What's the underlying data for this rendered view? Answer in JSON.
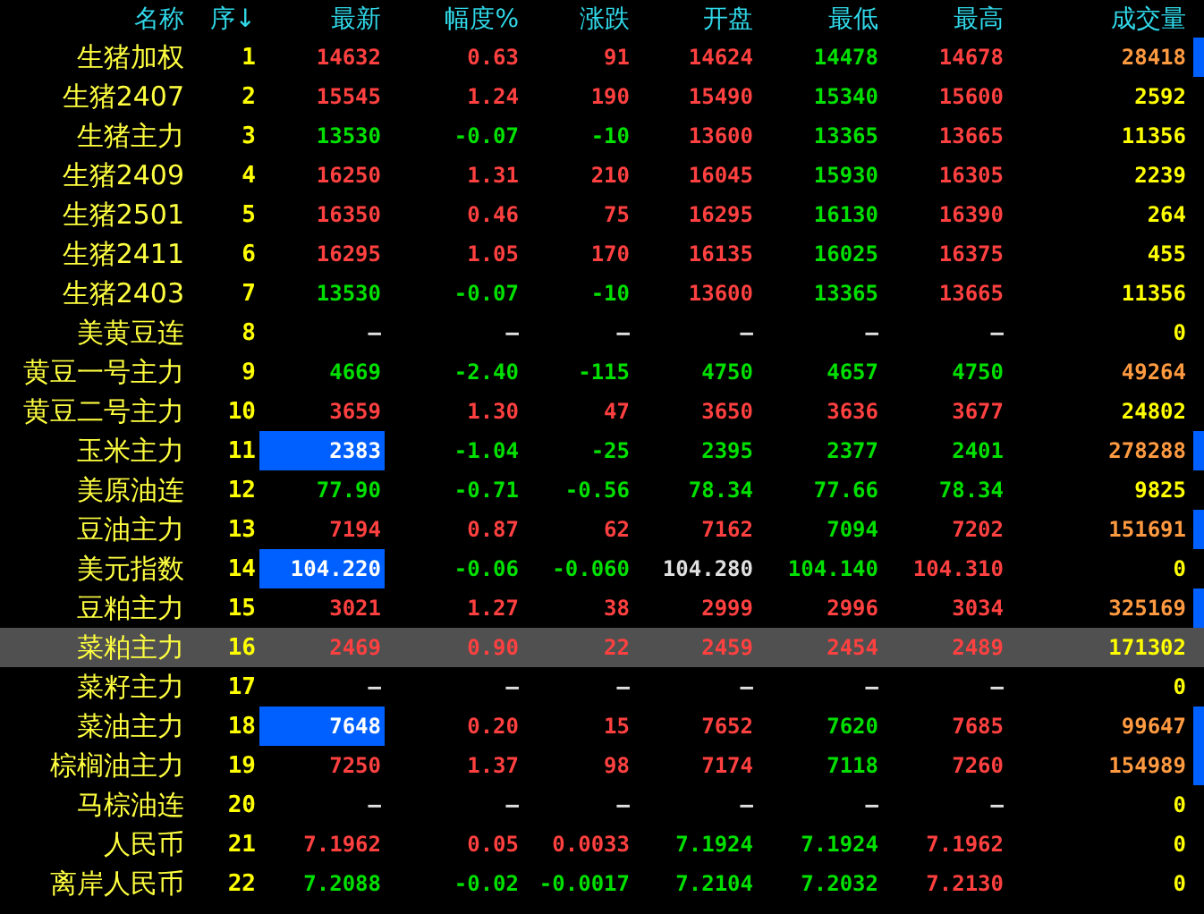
{
  "columns": [
    "名称",
    "序↓",
    "最新",
    "幅度%",
    "涨跌",
    "开盘",
    "最低",
    "最高",
    "成交量"
  ],
  "rows": [
    {
      "name": "生猪加权",
      "seq": "1",
      "selected": false,
      "marker": true,
      "flash": false,
      "cells": [
        {
          "text": "14632",
          "color": "#ff4040"
        },
        {
          "text": "0.63",
          "color": "#ff4040"
        },
        {
          "text": "91",
          "color": "#ff4040"
        },
        {
          "text": "14624",
          "color": "#ff4040"
        },
        {
          "text": "14478",
          "color": "#00e000"
        },
        {
          "text": "14678",
          "color": "#ff4040"
        },
        {
          "text": "28418",
          "color": "#ff9a40"
        }
      ]
    },
    {
      "name": "生猪2407",
      "seq": "2",
      "selected": false,
      "marker": false,
      "flash": false,
      "cells": [
        {
          "text": "15545",
          "color": "#ff4040"
        },
        {
          "text": "1.24",
          "color": "#ff4040"
        },
        {
          "text": "190",
          "color": "#ff4040"
        },
        {
          "text": "15490",
          "color": "#ff4040"
        },
        {
          "text": "15340",
          "color": "#00e000"
        },
        {
          "text": "15600",
          "color": "#ff4040"
        },
        {
          "text": "2592",
          "color": "#ffff00"
        }
      ]
    },
    {
      "name": "生猪主力",
      "seq": "3",
      "selected": false,
      "marker": false,
      "flash": false,
      "cells": [
        {
          "text": "13530",
          "color": "#00e000"
        },
        {
          "text": "-0.07",
          "color": "#00e000"
        },
        {
          "text": "-10",
          "color": "#00e000"
        },
        {
          "text": "13600",
          "color": "#ff4040"
        },
        {
          "text": "13365",
          "color": "#00e000"
        },
        {
          "text": "13665",
          "color": "#ff4040"
        },
        {
          "text": "11356",
          "color": "#ffff00"
        }
      ]
    },
    {
      "name": "生猪2409",
      "seq": "4",
      "selected": false,
      "marker": false,
      "flash": false,
      "cells": [
        {
          "text": "16250",
          "color": "#ff4040"
        },
        {
          "text": "1.31",
          "color": "#ff4040"
        },
        {
          "text": "210",
          "color": "#ff4040"
        },
        {
          "text": "16045",
          "color": "#ff4040"
        },
        {
          "text": "15930",
          "color": "#00e000"
        },
        {
          "text": "16305",
          "color": "#ff4040"
        },
        {
          "text": "2239",
          "color": "#ffff00"
        }
      ]
    },
    {
      "name": "生猪2501",
      "seq": "5",
      "selected": false,
      "marker": false,
      "flash": false,
      "cells": [
        {
          "text": "16350",
          "color": "#ff4040"
        },
        {
          "text": "0.46",
          "color": "#ff4040"
        },
        {
          "text": "75",
          "color": "#ff4040"
        },
        {
          "text": "16295",
          "color": "#ff4040"
        },
        {
          "text": "16130",
          "color": "#00e000"
        },
        {
          "text": "16390",
          "color": "#ff4040"
        },
        {
          "text": "264",
          "color": "#ffff00"
        }
      ]
    },
    {
      "name": "生猪2411",
      "seq": "6",
      "selected": false,
      "marker": false,
      "flash": false,
      "cells": [
        {
          "text": "16295",
          "color": "#ff4040"
        },
        {
          "text": "1.05",
          "color": "#ff4040"
        },
        {
          "text": "170",
          "color": "#ff4040"
        },
        {
          "text": "16135",
          "color": "#ff4040"
        },
        {
          "text": "16025",
          "color": "#00e000"
        },
        {
          "text": "16375",
          "color": "#ff4040"
        },
        {
          "text": "455",
          "color": "#ffff00"
        }
      ]
    },
    {
      "name": "生猪2403",
      "seq": "7",
      "selected": false,
      "marker": false,
      "flash": false,
      "cells": [
        {
          "text": "13530",
          "color": "#00e000"
        },
        {
          "text": "-0.07",
          "color": "#00e000"
        },
        {
          "text": "-10",
          "color": "#00e000"
        },
        {
          "text": "13600",
          "color": "#ff4040"
        },
        {
          "text": "13365",
          "color": "#00e000"
        },
        {
          "text": "13665",
          "color": "#ff4040"
        },
        {
          "text": "11356",
          "color": "#ffff00"
        }
      ]
    },
    {
      "name": "美黄豆连",
      "seq": "8",
      "selected": false,
      "marker": false,
      "flash": false,
      "cells": [
        {
          "text": "—",
          "color": "#e0e0e0"
        },
        {
          "text": "—",
          "color": "#e0e0e0"
        },
        {
          "text": "—",
          "color": "#e0e0e0"
        },
        {
          "text": "—",
          "color": "#e0e0e0"
        },
        {
          "text": "—",
          "color": "#e0e0e0"
        },
        {
          "text": "—",
          "color": "#e0e0e0"
        },
        {
          "text": "0",
          "color": "#ffff00"
        }
      ]
    },
    {
      "name": "黄豆一号主力",
      "seq": "9",
      "selected": false,
      "marker": false,
      "flash": false,
      "cells": [
        {
          "text": "4669",
          "color": "#00e000"
        },
        {
          "text": "-2.40",
          "color": "#00e000"
        },
        {
          "text": "-115",
          "color": "#00e000"
        },
        {
          "text": "4750",
          "color": "#00e000"
        },
        {
          "text": "4657",
          "color": "#00e000"
        },
        {
          "text": "4750",
          "color": "#00e000"
        },
        {
          "text": "49264",
          "color": "#ff9a40"
        }
      ]
    },
    {
      "name": "黄豆二号主力",
      "seq": "10",
      "selected": false,
      "marker": false,
      "flash": false,
      "cells": [
        {
          "text": "3659",
          "color": "#ff4040"
        },
        {
          "text": "1.30",
          "color": "#ff4040"
        },
        {
          "text": "47",
          "color": "#ff4040"
        },
        {
          "text": "3650",
          "color": "#ff4040"
        },
        {
          "text": "3636",
          "color": "#ff4040"
        },
        {
          "text": "3677",
          "color": "#ff4040"
        },
        {
          "text": "24802",
          "color": "#ffff00"
        }
      ]
    },
    {
      "name": "玉米主力",
      "seq": "11",
      "selected": false,
      "marker": true,
      "flash": true,
      "cells": [
        {
          "text": "2383",
          "color": "#ffffff"
        },
        {
          "text": "-1.04",
          "color": "#00e000"
        },
        {
          "text": "-25",
          "color": "#00e000"
        },
        {
          "text": "2395",
          "color": "#00e000"
        },
        {
          "text": "2377",
          "color": "#00e000"
        },
        {
          "text": "2401",
          "color": "#00e000"
        },
        {
          "text": "278288",
          "color": "#ff9a40"
        }
      ]
    },
    {
      "name": "美原油连",
      "seq": "12",
      "selected": false,
      "marker": false,
      "flash": false,
      "cells": [
        {
          "text": "77.90",
          "color": "#00e000"
        },
        {
          "text": "-0.71",
          "color": "#00e000"
        },
        {
          "text": "-0.56",
          "color": "#00e000"
        },
        {
          "text": "78.34",
          "color": "#00e000"
        },
        {
          "text": "77.66",
          "color": "#00e000"
        },
        {
          "text": "78.34",
          "color": "#00e000"
        },
        {
          "text": "9825",
          "color": "#ffff00"
        }
      ]
    },
    {
      "name": "豆油主力",
      "seq": "13",
      "selected": false,
      "marker": true,
      "flash": false,
      "cells": [
        {
          "text": "7194",
          "color": "#ff4040"
        },
        {
          "text": "0.87",
          "color": "#ff4040"
        },
        {
          "text": "62",
          "color": "#ff4040"
        },
        {
          "text": "7162",
          "color": "#ff4040"
        },
        {
          "text": "7094",
          "color": "#00e000"
        },
        {
          "text": "7202",
          "color": "#ff4040"
        },
        {
          "text": "151691",
          "color": "#ff9a40"
        }
      ]
    },
    {
      "name": "美元指数",
      "seq": "14",
      "selected": false,
      "marker": false,
      "flash": true,
      "cells": [
        {
          "text": "104.220",
          "color": "#ffffff"
        },
        {
          "text": "-0.06",
          "color": "#00e000"
        },
        {
          "text": "-0.060",
          "color": "#00e000"
        },
        {
          "text": "104.280",
          "color": "#e0e0e0"
        },
        {
          "text": "104.140",
          "color": "#00e000"
        },
        {
          "text": "104.310",
          "color": "#ff4040"
        },
        {
          "text": "0",
          "color": "#ffff00"
        }
      ]
    },
    {
      "name": "豆粕主力",
      "seq": "15",
      "selected": false,
      "marker": true,
      "flash": false,
      "cells": [
        {
          "text": "3021",
          "color": "#ff4040"
        },
        {
          "text": "1.27",
          "color": "#ff4040"
        },
        {
          "text": "38",
          "color": "#ff4040"
        },
        {
          "text": "2999",
          "color": "#ff4040"
        },
        {
          "text": "2996",
          "color": "#ff4040"
        },
        {
          "text": "3034",
          "color": "#ff4040"
        },
        {
          "text": "325169",
          "color": "#ff9a40"
        }
      ]
    },
    {
      "name": "菜粕主力",
      "seq": "16",
      "selected": true,
      "marker": false,
      "flash": false,
      "cells": [
        {
          "text": "2469",
          "color": "#ff4040"
        },
        {
          "text": "0.90",
          "color": "#ff4040"
        },
        {
          "text": "22",
          "color": "#ff4040"
        },
        {
          "text": "2459",
          "color": "#ff4040"
        },
        {
          "text": "2454",
          "color": "#ff4040"
        },
        {
          "text": "2489",
          "color": "#ff4040"
        },
        {
          "text": "171302",
          "color": "#ffff00"
        }
      ]
    },
    {
      "name": "菜籽主力",
      "seq": "17",
      "selected": false,
      "marker": false,
      "flash": false,
      "cells": [
        {
          "text": "—",
          "color": "#e0e0e0"
        },
        {
          "text": "—",
          "color": "#e0e0e0"
        },
        {
          "text": "—",
          "color": "#e0e0e0"
        },
        {
          "text": "—",
          "color": "#e0e0e0"
        },
        {
          "text": "—",
          "color": "#e0e0e0"
        },
        {
          "text": "—",
          "color": "#e0e0e0"
        },
        {
          "text": "0",
          "color": "#ffff00"
        }
      ]
    },
    {
      "name": "菜油主力",
      "seq": "18",
      "selected": false,
      "marker": true,
      "flash": true,
      "cells": [
        {
          "text": "7648",
          "color": "#ffffff"
        },
        {
          "text": "0.20",
          "color": "#ff4040"
        },
        {
          "text": "15",
          "color": "#ff4040"
        },
        {
          "text": "7652",
          "color": "#ff4040"
        },
        {
          "text": "7620",
          "color": "#00e000"
        },
        {
          "text": "7685",
          "color": "#ff4040"
        },
        {
          "text": "99647",
          "color": "#ff9a40"
        }
      ]
    },
    {
      "name": "棕榈油主力",
      "seq": "19",
      "selected": false,
      "marker": true,
      "flash": false,
      "cells": [
        {
          "text": "7250",
          "color": "#ff4040"
        },
        {
          "text": "1.37",
          "color": "#ff4040"
        },
        {
          "text": "98",
          "color": "#ff4040"
        },
        {
          "text": "7174",
          "color": "#ff4040"
        },
        {
          "text": "7118",
          "color": "#00e000"
        },
        {
          "text": "7260",
          "color": "#ff4040"
        },
        {
          "text": "154989",
          "color": "#ff9a40"
        }
      ]
    },
    {
      "name": "马棕油连",
      "seq": "20",
      "selected": false,
      "marker": false,
      "flash": false,
      "cells": [
        {
          "text": "—",
          "color": "#e0e0e0"
        },
        {
          "text": "—",
          "color": "#e0e0e0"
        },
        {
          "text": "—",
          "color": "#e0e0e0"
        },
        {
          "text": "—",
          "color": "#e0e0e0"
        },
        {
          "text": "—",
          "color": "#e0e0e0"
        },
        {
          "text": "—",
          "color": "#e0e0e0"
        },
        {
          "text": "0",
          "color": "#ffff00"
        }
      ]
    },
    {
      "name": "人民币",
      "seq": "21",
      "selected": false,
      "marker": false,
      "flash": false,
      "cells": [
        {
          "text": "7.1962",
          "color": "#ff4040"
        },
        {
          "text": "0.05",
          "color": "#ff4040"
        },
        {
          "text": "0.0033",
          "color": "#ff4040"
        },
        {
          "text": "7.1924",
          "color": "#00e000"
        },
        {
          "text": "7.1924",
          "color": "#00e000"
        },
        {
          "text": "7.1962",
          "color": "#ff4040"
        },
        {
          "text": "0",
          "color": "#ffff00"
        }
      ]
    },
    {
      "name": "离岸人民币",
      "seq": "22",
      "selected": false,
      "marker": false,
      "flash": false,
      "cells": [
        {
          "text": "7.2088",
          "color": "#00e000"
        },
        {
          "text": "-0.02",
          "color": "#00e000"
        },
        {
          "text": "-0.0017",
          "color": "#00e000"
        },
        {
          "text": "7.2104",
          "color": "#00e000"
        },
        {
          "text": "7.2032",
          "color": "#00e000"
        },
        {
          "text": "7.2130",
          "color": "#ff4040"
        },
        {
          "text": "0",
          "color": "#ffff00"
        }
      ]
    }
  ]
}
